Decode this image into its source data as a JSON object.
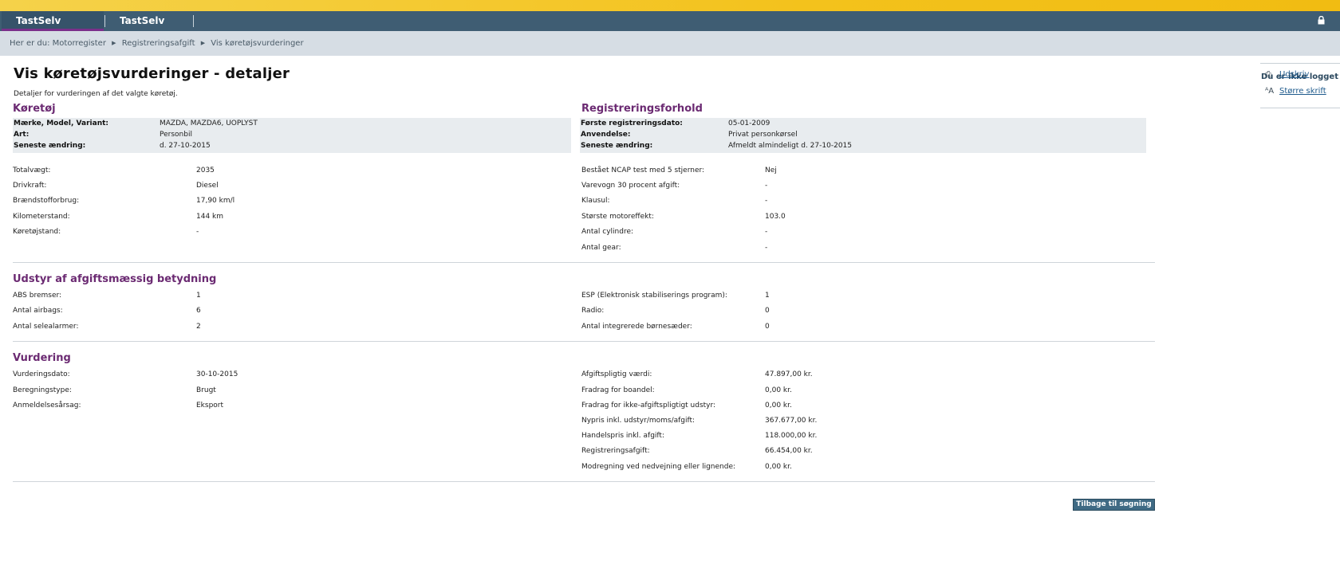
{
  "nav": {
    "tabs": [
      {
        "label": "TastSelv Borger"
      },
      {
        "label": "TastSelv Erhverv"
      }
    ],
    "logout_label": "Lo"
  },
  "breadcrumb": {
    "prefix": "Her er du:",
    "items": [
      "Motorregister",
      "Registreringsafgift",
      "Vis køretøjsvurderinger"
    ]
  },
  "page": {
    "title": "Vis køretøjsvurderinger - detaljer",
    "intro": "Detaljer for vurderingen af det valgte køretøj."
  },
  "vehicle": {
    "heading": "Køretøj",
    "summary": [
      {
        "label": "Mærke, Model, Variant:",
        "value": "MAZDA, MAZDA6, UOPLYST"
      },
      {
        "label": "Art:",
        "value": "Personbil"
      },
      {
        "label": "Seneste ændring:",
        "value": "d. 27-10-2015"
      }
    ],
    "details": [
      {
        "label": "Totalvægt:",
        "value": "2035"
      },
      {
        "label": "Drivkraft:",
        "value": "Diesel"
      },
      {
        "label": "Brændstofforbrug:",
        "value": "17,90 km/l"
      },
      {
        "label": "Kilometerstand:",
        "value": "144 km"
      },
      {
        "label": "Køretøjstand:",
        "value": "-"
      }
    ]
  },
  "registration": {
    "heading": "Registreringsforhold",
    "summary": [
      {
        "label": "Første registreringsdato:",
        "value": "05-01-2009"
      },
      {
        "label": "Anvendelse:",
        "value": "Privat personkørsel"
      },
      {
        "label": "Seneste ændring:",
        "value": "Afmeldt almindeligt d. 27-10-2015"
      }
    ],
    "details": [
      {
        "label": "Bestået NCAP test med 5 stjerner:",
        "value": "Nej"
      },
      {
        "label": "Varevogn 30 procent afgift:",
        "value": "-"
      },
      {
        "label": "Klausul:",
        "value": "-"
      },
      {
        "label": "Største motoreffekt:",
        "value": "103.0"
      },
      {
        "label": "Antal cylindre:",
        "value": "-"
      },
      {
        "label": "Antal gear:",
        "value": "-"
      }
    ]
  },
  "equipment": {
    "heading": "Udstyr af afgiftsmæssig betydning",
    "left": [
      {
        "label": "ABS bremser:",
        "value": "1"
      },
      {
        "label": "Antal airbags:",
        "value": "6"
      },
      {
        "label": "Antal selealarmer:",
        "value": "2"
      }
    ],
    "right": [
      {
        "label": "ESP (Elektronisk stabiliserings program):",
        "value": "1"
      },
      {
        "label": "Radio:",
        "value": "0"
      },
      {
        "label": "Antal integrerede børnesæder:",
        "value": "0"
      }
    ]
  },
  "valuation": {
    "heading": "Vurdering",
    "left": [
      {
        "label": "Vurderingsdato:",
        "value": "30-10-2015"
      },
      {
        "label": "Beregningstype:",
        "value": "Brugt"
      },
      {
        "label": "Anmeldelsesårsag:",
        "value": "Eksport"
      }
    ],
    "right": [
      {
        "label": "Afgiftspligtig værdi:",
        "value": "47.897,00 kr."
      },
      {
        "label": "Fradrag for boandel:",
        "value": "0,00 kr."
      },
      {
        "label": "Fradrag for ikke-afgiftspligtigt udstyr:",
        "value": "0,00 kr."
      },
      {
        "label": "Nypris inkl. udstyr/moms/afgift:",
        "value": "367.677,00 kr."
      },
      {
        "label": "Handelspris inkl. afgift:",
        "value": "118.000,00 kr."
      },
      {
        "label": "Registreringsafgift:",
        "value": "66.454,00 kr."
      },
      {
        "label": "Modregning ved nedvejning eller lignende:",
        "value": "0,00 kr."
      }
    ]
  },
  "sidebar": {
    "login_note": "Du er ikke logget",
    "print_label": "Udskriv",
    "bigger_text_label": "Større skrift"
  },
  "buttons": {
    "back_label": "Tilbage til søgning"
  }
}
